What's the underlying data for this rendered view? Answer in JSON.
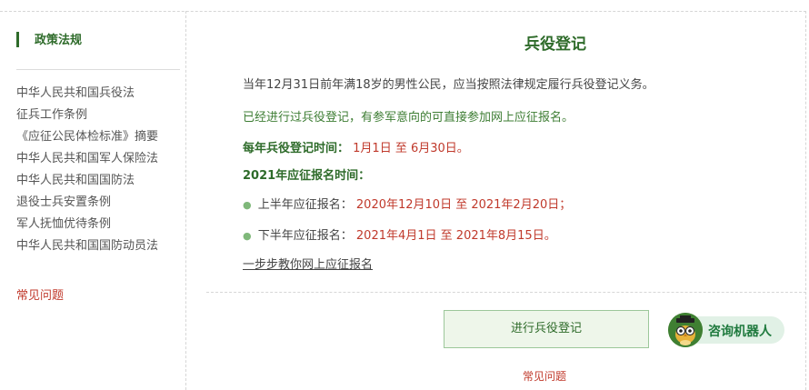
{
  "sidebar": {
    "title": "政策法规",
    "items": [
      {
        "label": "中华人民共和国兵役法"
      },
      {
        "label": "征兵工作条例"
      },
      {
        "label": "《应征公民体检标准》摘要"
      },
      {
        "label": "中华人民共和国军人保险法"
      },
      {
        "label": "中华人民共和国国防法"
      },
      {
        "label": "退役士兵安置条例"
      },
      {
        "label": "军人抚恤优待条例"
      },
      {
        "label": "中华人民共和国国防动员法"
      }
    ],
    "faq": "常见问题"
  },
  "main": {
    "title": "兵役登记",
    "line1": "当年12月31日前年满18岁的男性公民，应当按照法律规定履行兵役登记义务。",
    "line2": "已经进行过兵役登记，有参军意向的可直接参加网上应征报名。",
    "registration_time_label": "每年兵役登记时间：",
    "registration_time_value": "1月1日 至 6月30日。",
    "enlistment_heading": "2021年应征报名时间：",
    "first_half_label": "上半年应征报名：",
    "first_half_value": "2020年12月10日 至 2021年2月20日；",
    "second_half_label": "下半年应征报名：",
    "second_half_value": "2021年4月1日 至 2021年8月15日。",
    "guide_link": "一步步教你网上应征报名",
    "register_button": "进行兵役登记",
    "robot_label": "咨询机器人",
    "faq": "常见问题"
  },
  "colors": {
    "brand_green": "#2e6b2a",
    "accent_red": "#c0392b",
    "button_bg": "#eef6ea",
    "robot_pill_bg": "#e1f1e6"
  },
  "icons": {
    "robot_avatar": "robot-avatar-icon"
  }
}
